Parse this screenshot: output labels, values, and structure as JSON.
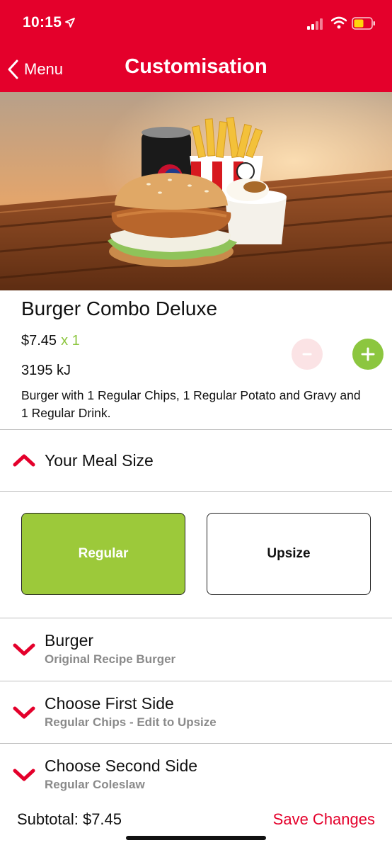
{
  "status_bar": {
    "time": "10:15"
  },
  "nav": {
    "back_label": "Menu",
    "title": "Customisation"
  },
  "product": {
    "name": "Burger Combo Deluxe",
    "price": "$7.45",
    "quantity": "x 1",
    "energy": "3195 kJ",
    "description": "Burger with 1 Regular Chips, 1 Regular Potato and Gravy and 1 Regular Drink."
  },
  "meal_size": {
    "title": "Your Meal Size",
    "options": [
      "Regular",
      "Upsize"
    ],
    "selected": "Regular"
  },
  "sections": [
    {
      "title": "Burger",
      "subtitle": "Original Recipe Burger"
    },
    {
      "title": "Choose First Side",
      "subtitle": "Regular Chips - Edit to Upsize"
    },
    {
      "title": "Choose Second Side",
      "subtitle": "Regular Coleslaw"
    }
  ],
  "footer": {
    "subtotal": "Subtotal: $7.45",
    "save_label": "Save Changes"
  },
  "colors": {
    "brand_red": "#e4002b",
    "accent_green": "#8cc63f",
    "selected_green": "#9cc93a"
  }
}
